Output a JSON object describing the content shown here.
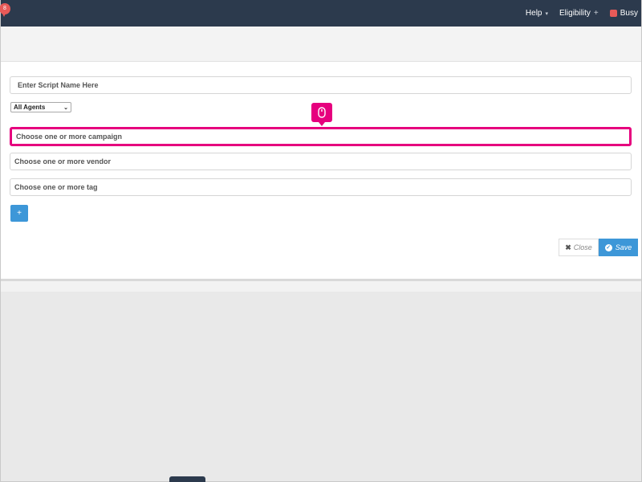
{
  "topbar": {
    "notification_count": "8",
    "help_label": "Help",
    "eligibility_label": "Eligibility",
    "status_label": "Busy",
    "status_color": "#e85a58"
  },
  "form": {
    "script_name_placeholder": "Enter Script Name Here",
    "agents_selected": "All Agents",
    "campaign_placeholder": "Choose one or more campaign",
    "vendor_placeholder": "Choose one or more vendor",
    "tag_placeholder": "Choose one or more tag",
    "add_label": "+",
    "close_label": "Close",
    "save_label": "Save"
  },
  "colors": {
    "accent": "#3d97d8",
    "highlight": "#e6007e",
    "header_bg": "#2c3a4d"
  },
  "icons": {
    "tooltip": "mouse-icon",
    "close": "x-icon",
    "save": "check-circle-icon"
  }
}
